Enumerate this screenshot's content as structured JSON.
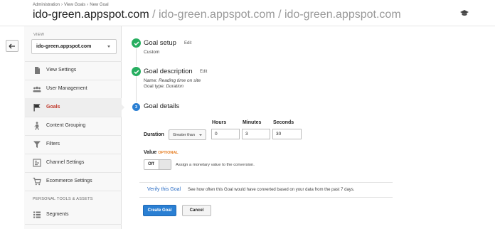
{
  "header": {
    "breadcrumb": [
      "Administration",
      "View Goals",
      "New Goal"
    ],
    "breadcrumb_sep": "›",
    "title_main": "ido-green.appspot.com",
    "title_rest": " / ido-green.appspot.com / ido-green.appspot.com",
    "icon": "graduation-cap-icon"
  },
  "sidebar": {
    "view_label": "VIEW",
    "view_value": "ido-green.appspot.com",
    "items": [
      {
        "label": "View Settings",
        "icon": "document-icon"
      },
      {
        "label": "User Management",
        "icon": "users-icon"
      },
      {
        "label": "Goals",
        "icon": "flag-icon",
        "active": true
      },
      {
        "label": "Content Grouping",
        "icon": "person-walking-icon"
      },
      {
        "label": "Filters",
        "icon": "funnel-icon"
      },
      {
        "label": "Channel Settings",
        "icon": "channel-icon"
      },
      {
        "label": "Ecommerce Settings",
        "icon": "cart-icon"
      }
    ],
    "section_label": "PERSONAL TOOLS & ASSETS",
    "section_items": [
      {
        "label": "Segments",
        "icon": "segments-icon"
      }
    ]
  },
  "steps": {
    "setup": {
      "title": "Goal setup",
      "edit": "Edit",
      "detail": "Custom"
    },
    "description": {
      "title": "Goal description",
      "edit": "Edit",
      "name_label": "Name: ",
      "name_value": "Reading time on site",
      "type_label": "Goal type: ",
      "type_value": "Duration"
    },
    "details": {
      "number": "3",
      "title": "Goal details"
    }
  },
  "duration": {
    "label": "Duration",
    "operator": "Greater than",
    "hours_label": "Hours",
    "hours_value": "0",
    "minutes_label": "Minutes",
    "minutes_value": "3",
    "seconds_label": "Seconds",
    "seconds_value": "30"
  },
  "value": {
    "label": "Value",
    "optional": "OPTIONAL",
    "toggle_label": "Off",
    "help": "Assign a monetary value to the conversion."
  },
  "verify": {
    "link": "Verify this Goal",
    "text": "See how often this Goal would have converted based on your data from the past 7 days."
  },
  "buttons": {
    "create": "Create Goal",
    "cancel": "Cancel"
  },
  "colors": {
    "accent": "#2a7fd3",
    "success": "#27ae60",
    "active_nav": "#c0392b",
    "optional": "#e67e22"
  }
}
